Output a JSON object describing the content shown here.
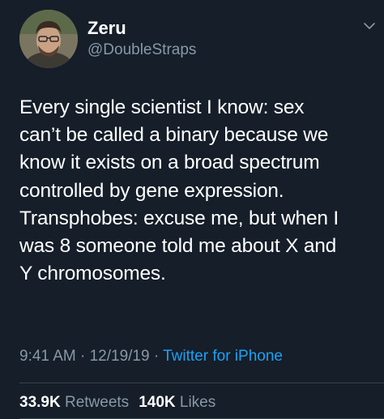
{
  "author": {
    "display_name": "Zeru",
    "handle": "@DoubleStraps"
  },
  "tweet": {
    "lines": [
      "Every single scientist I know: sex",
      "can’t be called a binary because we",
      "know it exists on a broad spectrum",
      "controlled by gene expression.",
      "Transphobes: excuse me, but when I",
      "was 8 someone told me about X and",
      "Y chromosomes."
    ]
  },
  "meta": {
    "time": "9:41 AM",
    "separator": " · ",
    "date": "12/19/19",
    "source": "Twitter for iPhone"
  },
  "stats": {
    "retweets_count": "33.9K",
    "retweets_label": "Retweets",
    "likes_count": "140K",
    "likes_label": "Likes"
  },
  "icons": {
    "avatar": "profile-photo",
    "menu": "chevron-down-icon"
  },
  "colors": {
    "background": "#151e29",
    "primary_text": "#ffffff",
    "secondary_text": "#8899a6",
    "link": "#1da1f2",
    "divider": "#38444d"
  }
}
